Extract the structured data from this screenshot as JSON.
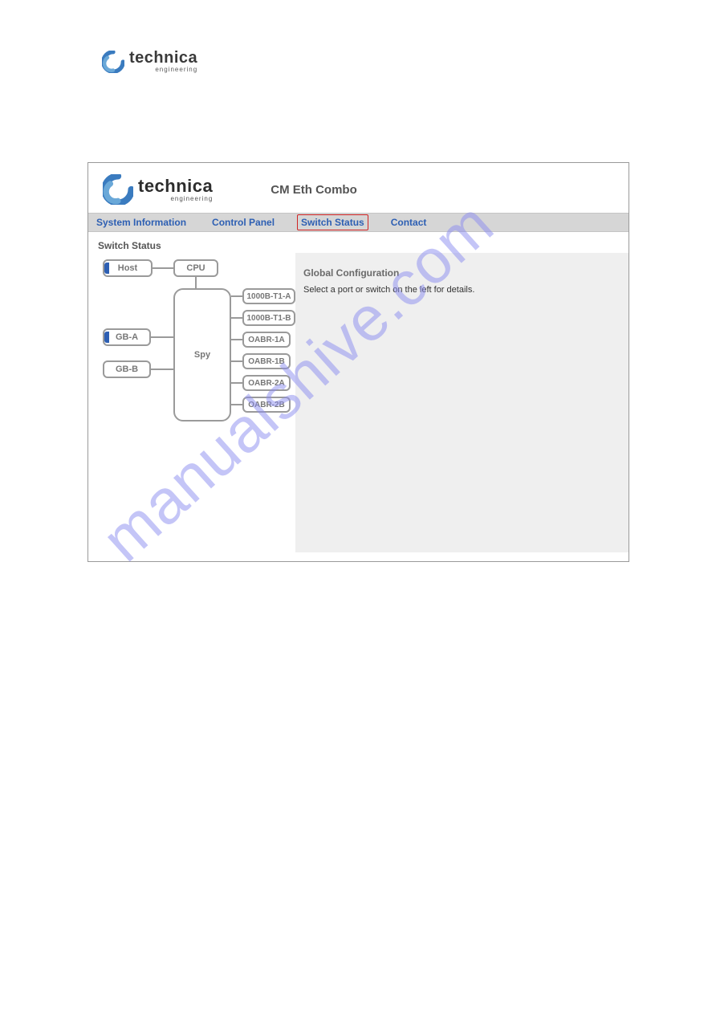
{
  "page_logo": {
    "brand": "technica",
    "subtitle": "engineering"
  },
  "app": {
    "brand": "technica",
    "subtitle": "engineering",
    "title": "CM Eth Combo"
  },
  "tabs": {
    "sys": "System Information",
    "control": "Control Panel",
    "switch": "Switch Status",
    "contact": "Contact"
  },
  "left": {
    "heading": "Switch Status",
    "nodes": {
      "host": "Host",
      "cpu": "CPU",
      "spy": "Spy",
      "gba": "GB-A",
      "gbb": "GB-B",
      "p1": "1000B-T1-A",
      "p2": "1000B-T1-B",
      "p3": "OABR-1A",
      "p4": "OABR-1B",
      "p5": "OABR-2A",
      "p6": "OABR-2B"
    }
  },
  "right": {
    "title": "Global Configuration",
    "message": "Select a port or switch on the left for details."
  },
  "watermark": "manualshive.com"
}
